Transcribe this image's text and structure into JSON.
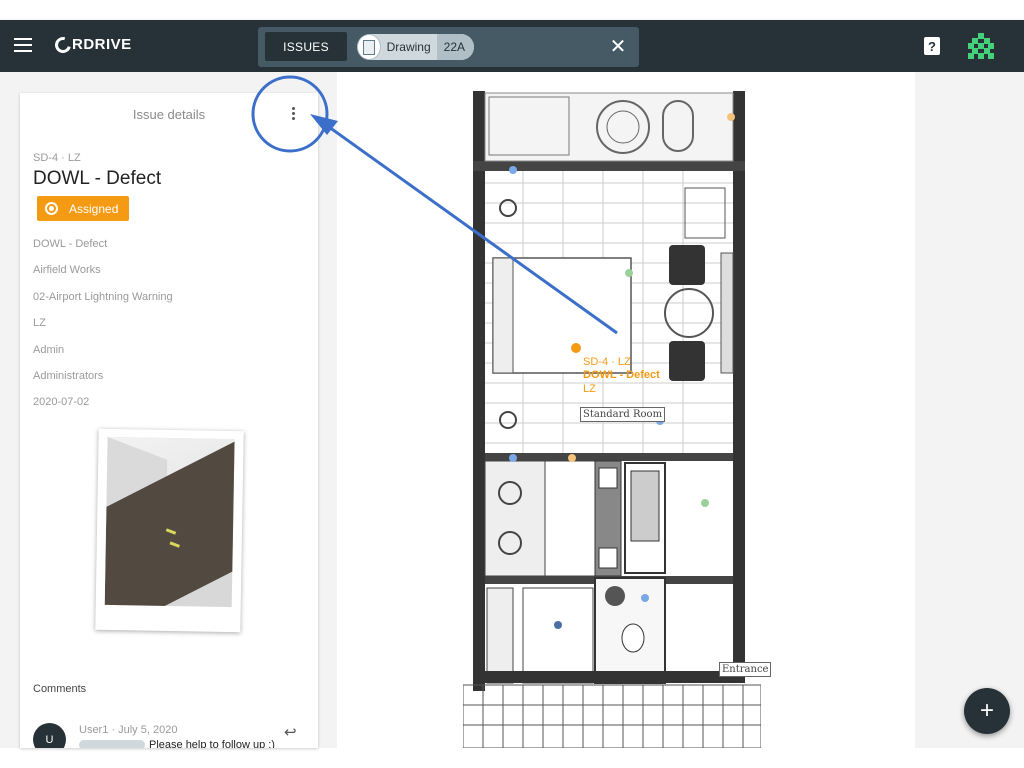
{
  "app": {
    "logo_text": "RDRIVE"
  },
  "toolbar": {
    "issues_label": "ISSUES",
    "chip_label": "Drawing",
    "chip_count": "22A"
  },
  "panel": {
    "title": "Issue details",
    "issue_id": "SD-4 · LZ",
    "issue_title": "DOWL - Defect",
    "status": "Assigned",
    "fields": [
      "DOWL - Defect",
      "Airfield Works",
      "02-Airport Lightning Warning",
      "LZ",
      "Admin",
      "Administrators",
      "2020-07-02"
    ],
    "comments_label": "Comments",
    "comment": {
      "avatar_initial": "U",
      "meta": "User1 · July 5, 2020",
      "text": "Please help to follow up :)"
    }
  },
  "drawing": {
    "pin_line1": "SD-4 · LZ",
    "pin_line2": "DOWL - Defect",
    "pin_line3": "LZ",
    "room_label": "Standard Room",
    "entrance_label": "Entrance"
  },
  "colors": {
    "appbar": "#263238",
    "status_orange": "#f59a13",
    "annotation_blue": "#3b6fc9"
  },
  "icons": {
    "menu": "hamburger-icon",
    "close": "close-icon",
    "help": "help-icon",
    "more": "more-vert-icon",
    "reply": "reply-icon",
    "add": "plus-icon"
  }
}
